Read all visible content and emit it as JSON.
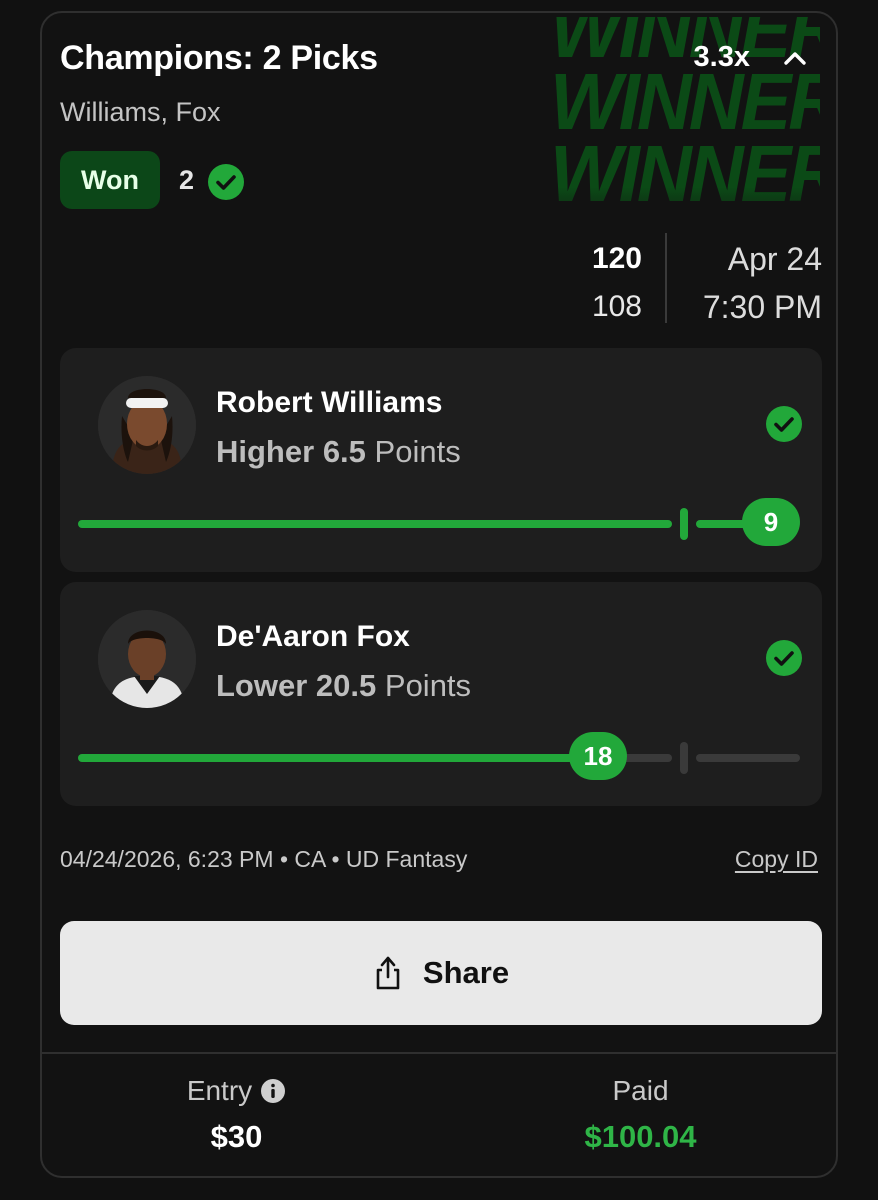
{
  "entry_card": {
    "title": "Champions: 2 Picks",
    "players_summary": "Williams, Fox",
    "multiplier": "3.3x",
    "watermark_text": "WINNER!!!",
    "status_badge": "Won",
    "won_count": "2",
    "game": {
      "score_top": "120",
      "score_bottom": "108",
      "date": "Apr 24",
      "time": "7:30 PM"
    },
    "picks": [
      {
        "player": "Robert Williams",
        "direction": "Higher",
        "line": "6.5",
        "stat": "Points",
        "result": "9",
        "progress": 1.0,
        "line_mark": 0.84
      },
      {
        "player": "De'Aaron Fox",
        "direction": "Lower",
        "line": "20.5",
        "stat": "Points",
        "result": "18",
        "progress": 0.72,
        "line_mark": 0.84
      }
    ],
    "meta": "04/24/2026, 6:23 PM • CA • UD Fantasy",
    "copy_id_label": "Copy ID",
    "share_label": "Share",
    "entry_label": "Entry",
    "entry_amount": "$30",
    "paid_label": "Paid",
    "paid_amount": "$100.04"
  },
  "colors": {
    "accent_green": "#22a83a",
    "badge_green": "#0c4718",
    "paid_green": "#2fb547",
    "track_gray": "#3a3a3a"
  },
  "icons": [
    "chevron-up-icon",
    "check-circle-icon",
    "share-icon",
    "info-icon"
  ]
}
